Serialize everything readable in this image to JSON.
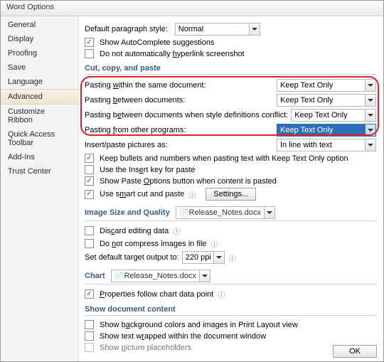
{
  "window_title": "Word Options",
  "sidebar": {
    "items": [
      {
        "label": "General"
      },
      {
        "label": "Display"
      },
      {
        "label": "Proofing"
      },
      {
        "label": "Save"
      },
      {
        "label": "Language"
      },
      {
        "label": "Advanced"
      },
      {
        "label": "Customize Ribbon"
      },
      {
        "label": "Quick Access Toolbar"
      },
      {
        "label": "Add-Ins"
      },
      {
        "label": "Trust Center"
      }
    ],
    "selected": "Advanced"
  },
  "top": {
    "def_para_style_label": "Default paragraph style:",
    "def_para_style_value": "Normal",
    "show_autocomplete": "Show AutoComplete suggestions",
    "no_auto_hyperlink": "Do not automatically hyperlink screenshot"
  },
  "ccp": {
    "title": "Cut, copy, and paste",
    "same_doc_label": "Pasting within the same document:",
    "same_doc_value": "Keep Text Only",
    "between_label": "Pasting between documents:",
    "between_value": "Keep Text Only",
    "between_conflict_label": "Pasting between documents when style definitions conflict:",
    "between_conflict_value": "Keep Text Only",
    "other_prog_label": "Pasting from other programs:",
    "other_prog_value": "Keep Text Only",
    "insert_pic_label": "Insert/paste pictures as:",
    "insert_pic_value": "In line with text",
    "keep_bullets": "Keep bullets and numbers when pasting text with Keep Text Only option",
    "use_insert_key": "Use the Insert key for paste",
    "show_paste_btn": "Show Paste Options button when content is pasted",
    "smart_cut": "Use smart cut and paste",
    "settings_btn": "Settings..."
  },
  "img_sect": {
    "title": "Image Size and Quality",
    "file_value": "Release_Notes.docx",
    "discard": "Discard editing data",
    "no_compress": "Do not compress images in file",
    "target_label": "Set default target output to:",
    "target_value": "220 ppi"
  },
  "chart_sect": {
    "title": "Chart",
    "file_value": "Release_Notes.docx",
    "props_follow": "Properties follow chart data point"
  },
  "show_doc": {
    "title": "Show document content",
    "show_bg": "Show background colors and images in Print Layout view",
    "text_wrapped": "Show text wrapped within the document window",
    "pic_placeholders": "Show picture placeholders"
  },
  "footer": {
    "ok": "OK"
  }
}
